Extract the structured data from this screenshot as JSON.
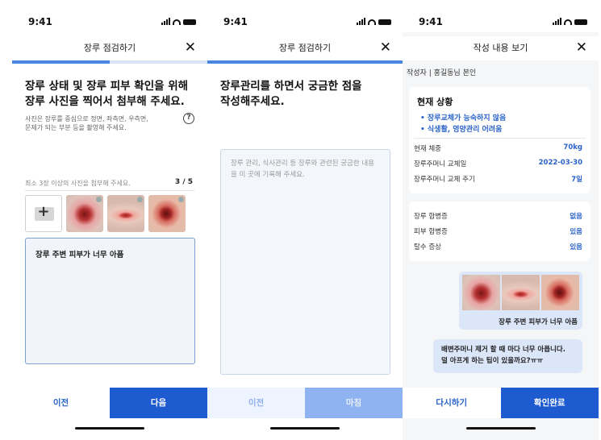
{
  "status_bar": {
    "time": "9:41"
  },
  "colors": {
    "primary": "#1e5bd1",
    "accent_text": "#2a62c8",
    "progress_track": "#d9e4f6"
  },
  "screen1": {
    "header_title": "장루 점검하기",
    "close_icon": "close-icon",
    "progress": 0.5,
    "heading": "장루 상태 및 장루 피부 확인을 위해\n장루 사진을 찍어서 첨부해 주세요.",
    "subtext": "사진은 장루를 중심으로 정면, 좌측면, 우측면,\n문제가 되는 부분 등을 촬영해 주세요.",
    "help_icon": "?",
    "photo_hint": "최소 3장 이상의 사진을 첨부해 주세요.",
    "photo_count": "3 / 5",
    "add_photo_symbol": "+",
    "textarea_value": "장루 주변 피부가 너무 아픔",
    "prev_label": "이전",
    "next_label": "다음"
  },
  "screen2": {
    "header_title": "장루 점검하기",
    "progress": 1.0,
    "heading": "장루관리를 하면서 궁금한 점을\n작성해주세요.",
    "textarea_placeholder": "장루 관리, 식사관리 등 장루와 관련된 궁금한 내용을 이 곳에 기록해 주세요.",
    "prev_label": "이전",
    "finish_label": "마침"
  },
  "screen3": {
    "header_title": "작성 내용 보기",
    "author": "작성자 | 홍길동님 본인",
    "current_status": {
      "title": "현재 상황",
      "bullets": [
        "• 장루교체가 능숙하지 않음",
        "• 식생활, 영양관리 어려움"
      ],
      "rows": [
        {
          "label": "현재 체중",
          "value": "70kg"
        },
        {
          "label": "장루주머니 교체일",
          "value": "2022-03-30"
        },
        {
          "label": "장루주머니 교체 주기",
          "value": "7일"
        }
      ]
    },
    "complications": [
      {
        "label": "장루 합병증",
        "value": "없음"
      },
      {
        "label": "피부 합병증",
        "value": "있음"
      },
      {
        "label": "탈수 증상",
        "value": "있음"
      }
    ],
    "photo_caption": "장루 주변 피부가 너무 아픔",
    "question": "배변주머니 제거 할 때 마다 너무 아픕니다.\n덜 아프게 하는 팁이 있을까요?ㅠㅠ",
    "retry_label": "다시하기",
    "confirm_label": "확인완료"
  }
}
